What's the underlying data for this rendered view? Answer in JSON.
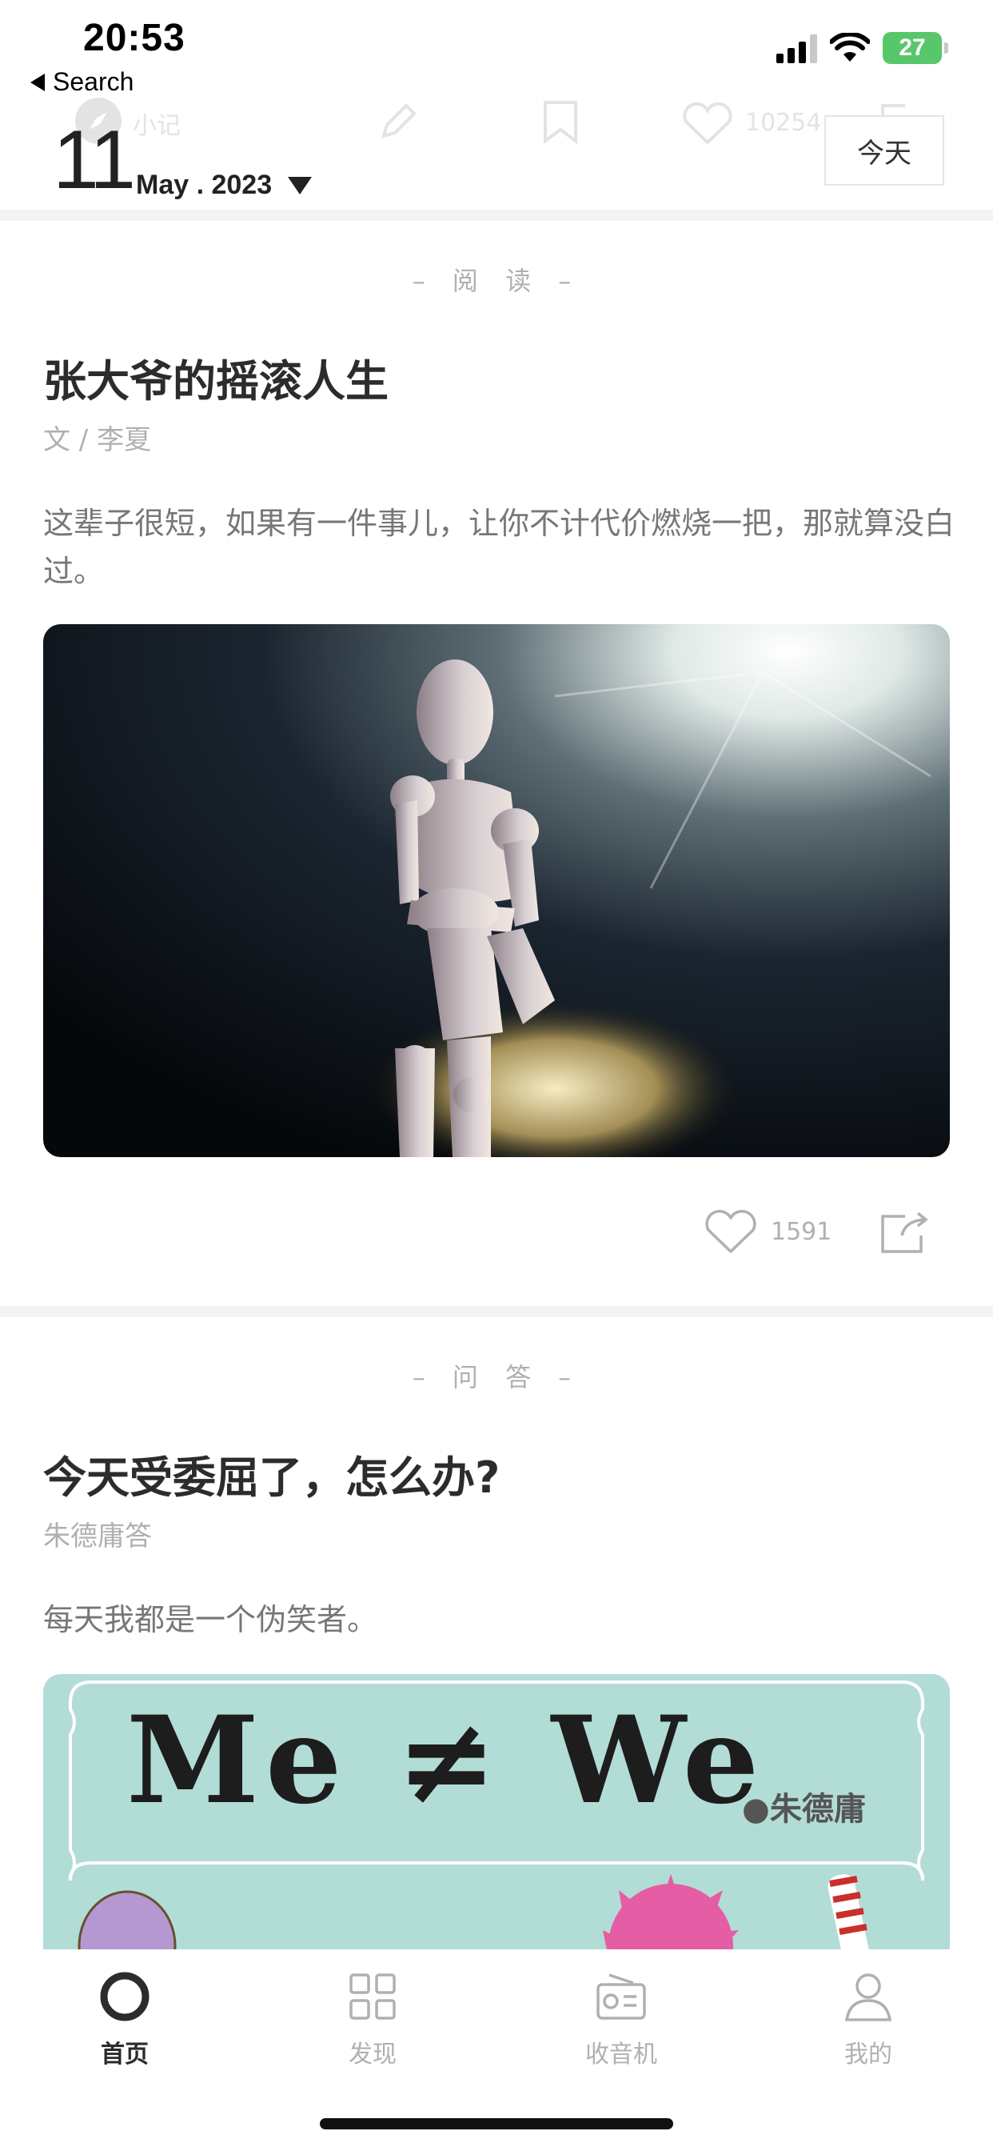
{
  "status_bar": {
    "time": "20:53",
    "back_label": "Search",
    "battery": "27"
  },
  "ghost_toolbar": {
    "app_name": "小记",
    "likes": "10254"
  },
  "date_header": {
    "day": "11",
    "month_year": "May . 2023",
    "today_button": "今天"
  },
  "articles": [
    {
      "category": "– 阅 读 –",
      "title": "张大爷的摇滚人生",
      "author": "文 / 李夏",
      "excerpt": "这辈子很短，如果有一件事儿，让你不计代价燃烧一把，那就算没白过。",
      "likes": "1591"
    },
    {
      "category": "– 问 答 –",
      "title": "今天受委屈了，怎么办?",
      "author": "朱德庸答",
      "excerpt": "每天我都是一个伪笑者。",
      "image_title": "Me ≠ We",
      "image_author": "●朱德庸"
    }
  ],
  "tab_bar": {
    "items": [
      {
        "label": "首页",
        "icon": "home-ring-icon",
        "active": true
      },
      {
        "label": "发现",
        "icon": "grid-icon",
        "active": false
      },
      {
        "label": "收音机",
        "icon": "radio-icon",
        "active": false
      },
      {
        "label": "我的",
        "icon": "user-icon",
        "active": false
      }
    ]
  },
  "colors": {
    "accent": "#2c2c2c",
    "muted": "#b0b0b0",
    "separator": "#f3f3f3",
    "battery": "#58c76b",
    "illustration_bg": "#b2ddd6"
  }
}
